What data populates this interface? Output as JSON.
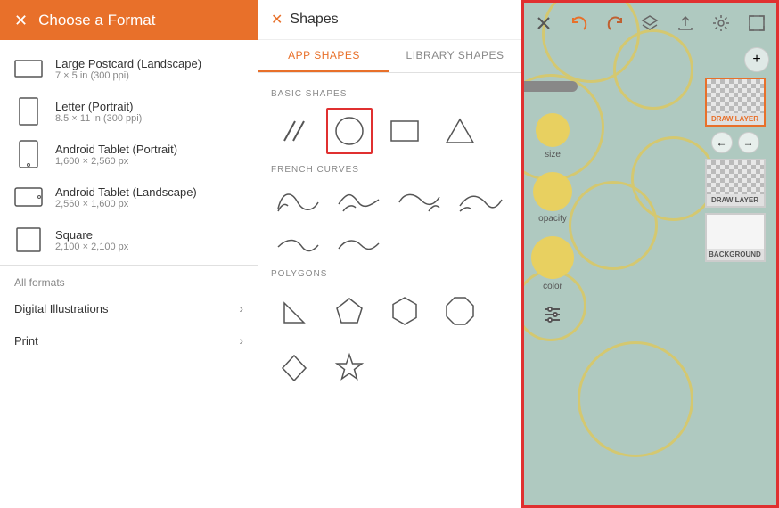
{
  "left_panel": {
    "header": {
      "title": "Choose a Format",
      "close_label": "✕"
    },
    "formats": [
      {
        "name": "Large Postcard (Landscape)",
        "size": "7 × 5 in (300 ppi)",
        "icon": "landscape-rect"
      },
      {
        "name": "Letter (Portrait)",
        "size": "8.5 × 11 in (300 ppi)",
        "icon": "portrait-rect"
      },
      {
        "name": "Android Tablet (Portrait)",
        "size": "1,600 × 2,560 px",
        "icon": "tablet-portrait"
      },
      {
        "name": "Android Tablet (Landscape)",
        "size": "2,560 × 1,600 px",
        "icon": "tablet-landscape"
      },
      {
        "name": "Square",
        "size": "2,100 × 2,100 px",
        "icon": "square-rect"
      }
    ],
    "all_formats_label": "All formats",
    "section_links": [
      {
        "label": "Digital Illustrations",
        "chevron": "›"
      },
      {
        "label": "Print",
        "chevron": "›"
      }
    ]
  },
  "middle_panel": {
    "header": {
      "close_label": "✕",
      "title": "Shapes"
    },
    "tabs": [
      {
        "label": "APP SHAPES",
        "active": true
      },
      {
        "label": "LIBRARY SHAPES",
        "active": false
      }
    ],
    "sections": [
      {
        "title": "BASIC SHAPES",
        "rows": [
          [
            "slash-lines",
            "circle-selected",
            "rectangle",
            "triangle"
          ]
        ]
      },
      {
        "title": "FRENCH CURVES",
        "rows": [
          [
            "curve1",
            "curve2",
            "curve3",
            "curve4"
          ],
          [
            "curve5",
            "curve6"
          ]
        ]
      },
      {
        "title": "POLYGONS",
        "rows": [
          [
            "triangle-small",
            "pentagon",
            "hexagon",
            "octagon"
          ],
          [
            "diamond",
            "star"
          ]
        ]
      }
    ]
  },
  "right_panel": {
    "toolbar_icons": [
      "close",
      "undo",
      "redo",
      "layers",
      "upload",
      "settings",
      "fullscreen"
    ],
    "layers": [
      {
        "label": "DRAW LAYER",
        "active": true,
        "type": "draw"
      },
      {
        "label": "DRAW LAYER",
        "active": false,
        "type": "draw"
      },
      {
        "label": "BACKGROUND",
        "active": false,
        "type": "bg"
      }
    ],
    "controls": [
      {
        "label": "size"
      },
      {
        "label": "opacity"
      },
      {
        "label": "color"
      }
    ],
    "add_layer_label": "+",
    "left_arrow": "←",
    "right_arrow": "→"
  },
  "colors": {
    "orange": "#E8702A",
    "red_border": "#e03030",
    "canvas_bg": "#afc9c0",
    "circle_yellow": "#e8d060",
    "white": "#ffffff"
  }
}
